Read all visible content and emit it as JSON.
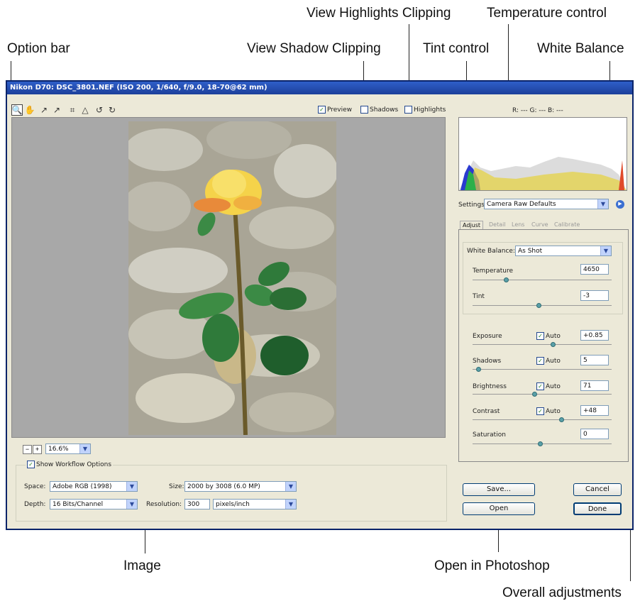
{
  "callouts": {
    "option_bar": "Option bar",
    "view_shadow_clipping": "View Shadow Clipping",
    "view_highlights_clipping": "View Highlights Clipping",
    "temperature_control": "Temperature control",
    "tint_control": "Tint control",
    "white_balance": "White Balance",
    "image": "Image",
    "open_in_photoshop": "Open in Photoshop",
    "overall_adjustments": "Overall adjustments"
  },
  "window": {
    "title": "Nikon D70:  DSC_3801.NEF  (ISO 200, 1/640, f/9.0, 18-70@62 mm)"
  },
  "toolbar": {
    "tools": [
      "zoom-icon",
      "hand-icon",
      "white-balance-icon",
      "color-sampler-icon",
      "crop-icon",
      "straighten-icon",
      "rotate-left-icon",
      "rotate-right-icon"
    ],
    "preview_label": "Preview",
    "preview_checked": true,
    "shadows_label": "Shadows",
    "shadows_checked": false,
    "highlights_label": "Highlights",
    "highlights_checked": false,
    "rgb_readout": "R: ---   G: ---   B: ---"
  },
  "zoom": {
    "value": "16.6%"
  },
  "workflow": {
    "show_label": "Show Workflow Options",
    "space_label": "Space:",
    "space_value": "Adobe RGB (1998)",
    "depth_label": "Depth:",
    "depth_value": "16 Bits/Channel",
    "size_label": "Size:",
    "size_value": "2000 by 3008  (6.0 MP)",
    "resolution_label": "Resolution:",
    "resolution_value": "300",
    "resolution_unit": "pixels/inch"
  },
  "settings": {
    "label": "Settings:",
    "value": "Camera Raw Defaults"
  },
  "tabs": [
    "Adjust",
    "Detail",
    "Lens",
    "Curve",
    "Calibrate"
  ],
  "adjust": {
    "white_balance_label": "White Balance:",
    "white_balance_value": "As Shot",
    "temperature_label": "Temperature",
    "temperature_value": "4650",
    "tint_label": "Tint",
    "tint_value": "-3",
    "exposure_label": "Exposure",
    "exposure_value": "+0.85",
    "shadows_label": "Shadows",
    "shadows_value": "5",
    "brightness_label": "Brightness",
    "brightness_value": "71",
    "contrast_label": "Contrast",
    "contrast_value": "+48",
    "saturation_label": "Saturation",
    "saturation_value": "0",
    "auto_label": "Auto"
  },
  "buttons": {
    "save": "Save...",
    "cancel": "Cancel",
    "open": "Open",
    "done": "Done"
  }
}
